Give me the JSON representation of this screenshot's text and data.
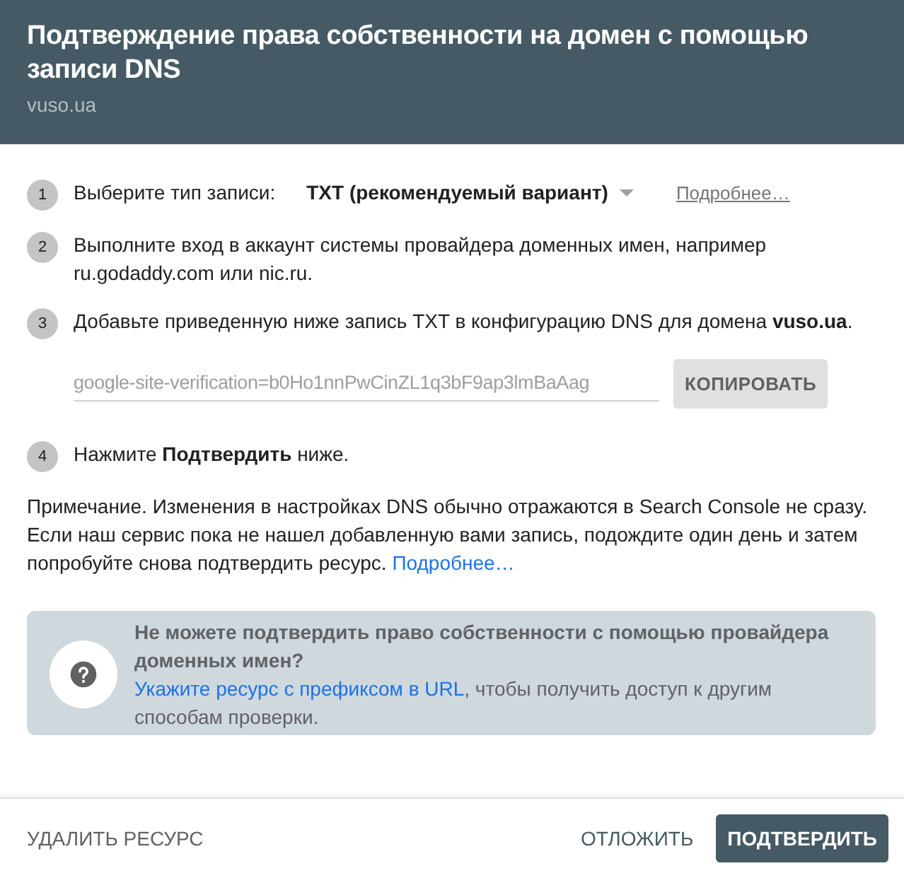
{
  "header": {
    "title": "Подтверждение права собственности на домен с помощью записи DNS",
    "subtitle": "vuso.ua"
  },
  "steps": [
    {
      "number": "1",
      "text": "Выберите тип записи:",
      "record_type": "TXT (рекомендуемый вариант)",
      "link": "Подробнее…"
    },
    {
      "number": "2",
      "text": "Выполните вход в аккаунт системы провайдера доменных имен, например ru.godaddy.com или nic.ru."
    },
    {
      "number": "3",
      "text": "Добавьте приведенную ниже запись TXT в конфигурацию DNS для домена **vuso.ua**.",
      "record": {
        "value": "google-site-verification=b0Ho1nnPwCinZL1q3bF9ap3lmBaAag",
        "copy_button": "КОПИРОВАТЬ"
      }
    },
    {
      "number": "4",
      "text": "Нажмите **Подтвердить** ниже."
    }
  ],
  "note": {
    "text": "Примечание. Изменения в настройках DNS обычно отражаются в Search Console не сразу. Если наш сервис пока не нашел добавленную вами запись, подождите один день и затем попробуйте снова подтвердить ресурс.",
    "link": "Подробнее…"
  },
  "help": {
    "title": "Не можете подтвердить право собственности с помощью провайдера доменных имен?",
    "link": "Укажите ресурс с префиксом в URL",
    "text": ", чтобы получить доступ к другим способам проверки."
  },
  "footer": {
    "delete": "УДАЛИТЬ РЕСУРС",
    "later": "ОТЛОЖИТЬ",
    "confirm": "ПОДТВЕРДИТЬ"
  }
}
